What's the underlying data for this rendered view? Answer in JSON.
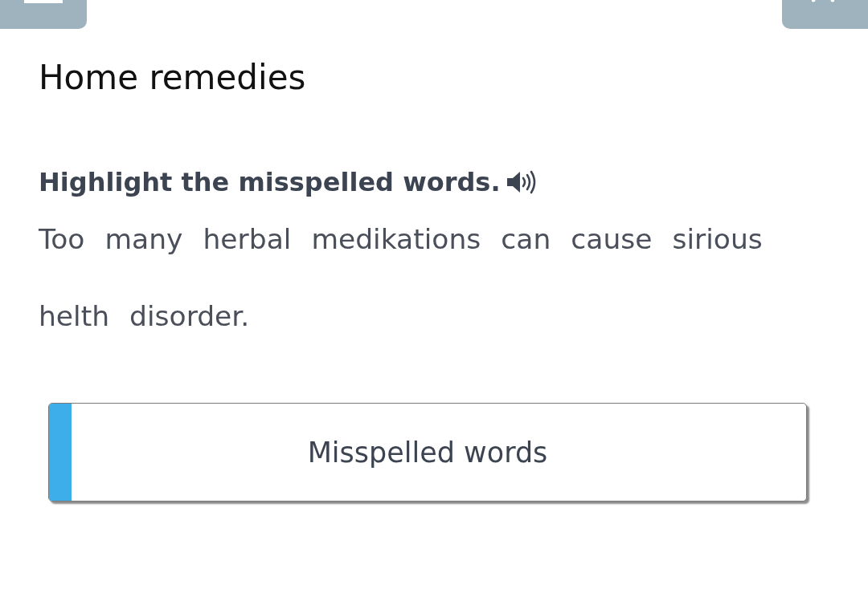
{
  "title": "Home remedies",
  "instruction": "Highlight the misspelled words.",
  "words": [
    {
      "text": "Too",
      "selected": false
    },
    {
      "text": "many",
      "selected": false
    },
    {
      "text": "herbal",
      "selected": false
    },
    {
      "text": "medikations",
      "selected": false
    },
    {
      "text": "can",
      "selected": false
    },
    {
      "text": "cause",
      "selected": false
    },
    {
      "text": "sirious",
      "selected": false
    },
    {
      "text": "helth",
      "selected": false
    },
    {
      "text": "disorder.",
      "selected": false
    }
  ],
  "categories": [
    {
      "label": "Misspelled words"
    }
  ]
}
